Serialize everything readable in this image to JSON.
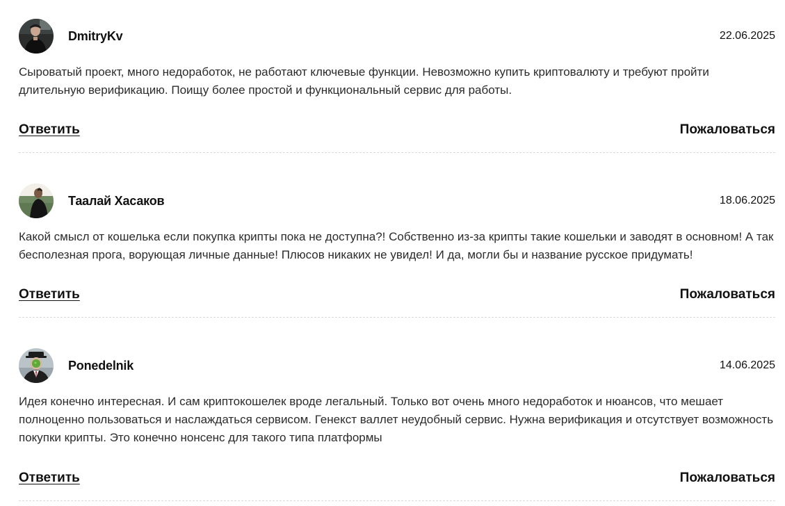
{
  "reviews": [
    {
      "author": "DmitryKv",
      "date": "22.06.2025",
      "text": "Сыроватый проект, много недоработок, не работают ключевые функции. Невозможно купить криптовалюту и требуют пройти длительную верификацию. Поищу более простой и функциональный сервис для работы.",
      "reply_label": "Ответить",
      "report_label": "Пожаловаться"
    },
    {
      "author": "Таалай Хасаков",
      "date": "18.06.2025",
      "text": "Какой смысл от кошелька если покупка крипты пока не доступна?! Собственно из-за крипты такие кошельки и заводят в основном! А так бесполезная прога, ворующая личные данные! Плюсов никаких не увидел! И да, могли бы и название русское придумать!",
      "reply_label": "Ответить",
      "report_label": "Пожаловаться"
    },
    {
      "author": "Ponedelnik",
      "date": "14.06.2025",
      "text": "Идея конечно интересная. И сам криптокошелек вроде легальный. Только вот очень много недоработок и нюансов, что мешает полноценно пользоваться и наслаждаться сервисом. Генекст валлет неудобный сервис. Нужна верификация и отсутствует возможность покупки крипты. Это конечно нонсенс для такого типа платформы",
      "reply_label": "Ответить",
      "report_label": "Пожаловаться"
    }
  ]
}
